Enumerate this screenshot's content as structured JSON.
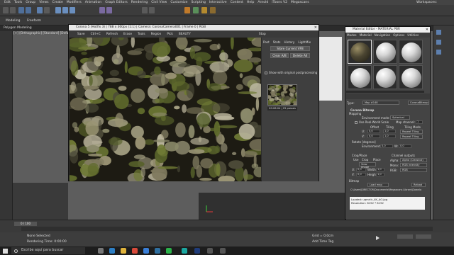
{
  "menu": [
    "Edit",
    "Tools",
    "Group",
    "Views",
    "Create",
    "Modifiers",
    "Animation",
    "Graph Editors",
    "Rendering",
    "Civil View",
    "Customize",
    "Scripting",
    "Interactive",
    "Content",
    "Help",
    "Arnold",
    "iToons V2",
    "Megascans"
  ],
  "workspaces": {
    "label": "Workspaces:"
  },
  "ribbon": {
    "tabs": [
      "Modeling",
      "Freeform"
    ],
    "sub": "Polygon Modeling"
  },
  "viewport": {
    "label": "[+] [Orthographic] [Standard] [Default Shadi"
  },
  "vfb": {
    "title": "Corona 5 (Hotfix 3) | 788 x 360px (1:1) | Camera: CoronaCamera001 | Frame 0 | RGB",
    "toolbar": [
      "Save",
      "Ctrl+C",
      "Refresh",
      "Erase",
      "Tools",
      "Region",
      "Pick",
      "BEAUTY",
      "Stop"
    ],
    "side_tabs": [
      "Post",
      "Stats",
      "History",
      "LightMix"
    ],
    "buttons": [
      "Store Current VFB",
      "Clear A/B",
      "Delete All"
    ],
    "option": "Show with original postprocessing",
    "thumb_caption": "00:06:04 | 25 passes"
  },
  "material_editor": {
    "title": "Material Editor - MATERIAL PBR",
    "menu": [
      "Modes",
      "Material",
      "Navigation",
      "Options",
      "Utilities"
    ],
    "type_label": "Type:",
    "type_value": "Map #148",
    "type_button": "CoronaBitmap",
    "rollout": "Corona Bitmap",
    "mapping_label": "Mapping",
    "env_label": "Environment mode:",
    "env_value": "Spherical",
    "realworld": "Use Real-World Scale",
    "map_channel_label": "Map channel:",
    "map_channel": "1",
    "col_offset": "Offset",
    "col_tiling": "Tiling",
    "col_mode": "Tiling Mode",
    "u_label": "U:",
    "u_offset": "0,0",
    "u_tiling": "1,0",
    "u_mode": "Repeat Tiling",
    "v_label": "V:",
    "v_offset": "0,0",
    "v_tiling": "1,0",
    "v_mode": "Repeat Tiling",
    "rotate_label": "Rotate [degrees]",
    "rotate_env": "Environment:",
    "rotate_env_value": "0,0",
    "rotate_w_label": "W:",
    "rotate_w_value": "0,0",
    "crop_label": "Crop/Place",
    "crop_use": "Use",
    "crop_crop": "Crop",
    "crop_place": "Place",
    "view_image": "View Image",
    "u_crop_value": "0,0",
    "w_label": "Width",
    "w_value": "1,0",
    "v_crop_value": "0,0",
    "h_label": "Height",
    "h_value": "1,0",
    "channel_label": "Channel outputs",
    "alpha_label": "Alpha:",
    "alpha_value": "Alpha (Classical)",
    "mono_label": "Mono:",
    "mono_value": "RGB intensity",
    "rgb_label": "RGB:",
    "rgb_value": "RGB",
    "bitmap_label": "Bitmap",
    "load_btn": "Load map",
    "reload_btn": "Reload",
    "path": "C:\\Users\\DIRECTOR\\Documents\\Megascans Library\\Downlo",
    "log_1": "Loaded: uqmrilr_4K_AO.jpg",
    "log_2": "Resolution: 8192 * 8192"
  },
  "timeline": {
    "frame": "0 / 100"
  },
  "status": {
    "selected": "None Selected",
    "rendering": "Rendering Time: 0:00:00",
    "grid": "Grid = 0,0cm",
    "timetag": "Add Time Tag"
  },
  "taskbar": {
    "search": "Escribe aquí para buscar"
  },
  "colors": {
    "accent": "#1e90ff",
    "vfb_bg": "#2d2d2d",
    "panel": "#444444"
  }
}
